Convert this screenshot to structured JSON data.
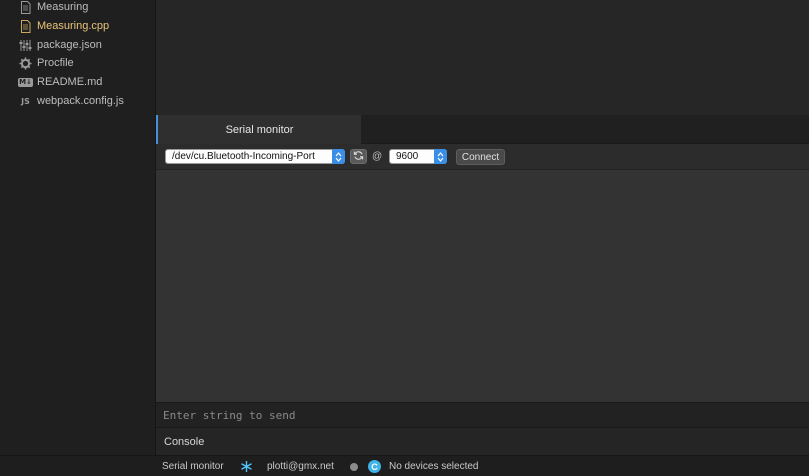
{
  "sidebar": {
    "files": [
      {
        "label": "Measuring",
        "icon": "file-text-icon",
        "active": false
      },
      {
        "label": "Measuring.cpp",
        "icon": "file-text-icon",
        "active": true
      },
      {
        "label": "package.json",
        "icon": "package-icon",
        "active": false
      },
      {
        "label": "Procfile",
        "icon": "gear-icon",
        "active": false
      },
      {
        "label": "README.md",
        "icon": "markdown-icon",
        "badge": "M↓",
        "active": false
      },
      {
        "label": "webpack.config.js",
        "icon": "javascript-icon",
        "badge": "JS",
        "active": false
      }
    ]
  },
  "serial_monitor": {
    "tab_label": "Serial monitor",
    "port_value": "/dev/cu.Bluetooth-Incoming-Port",
    "at_label": "@",
    "baud_value": "9600",
    "connect_label": "Connect",
    "send_placeholder": "Enter string to send"
  },
  "console": {
    "title": "Console"
  },
  "status_bar": {
    "serial_monitor_label": "Serial monitor",
    "user_email": "plotti@gmx.net",
    "device_badge": "C",
    "devices_label": "No devices selected"
  },
  "colors": {
    "accent": "#4a90d9",
    "active_file": "#e8c47a",
    "select_arrow": "#3a8ee6",
    "particle_icon": "#4fc3f7",
    "device_badge": "#3fb3e8"
  }
}
